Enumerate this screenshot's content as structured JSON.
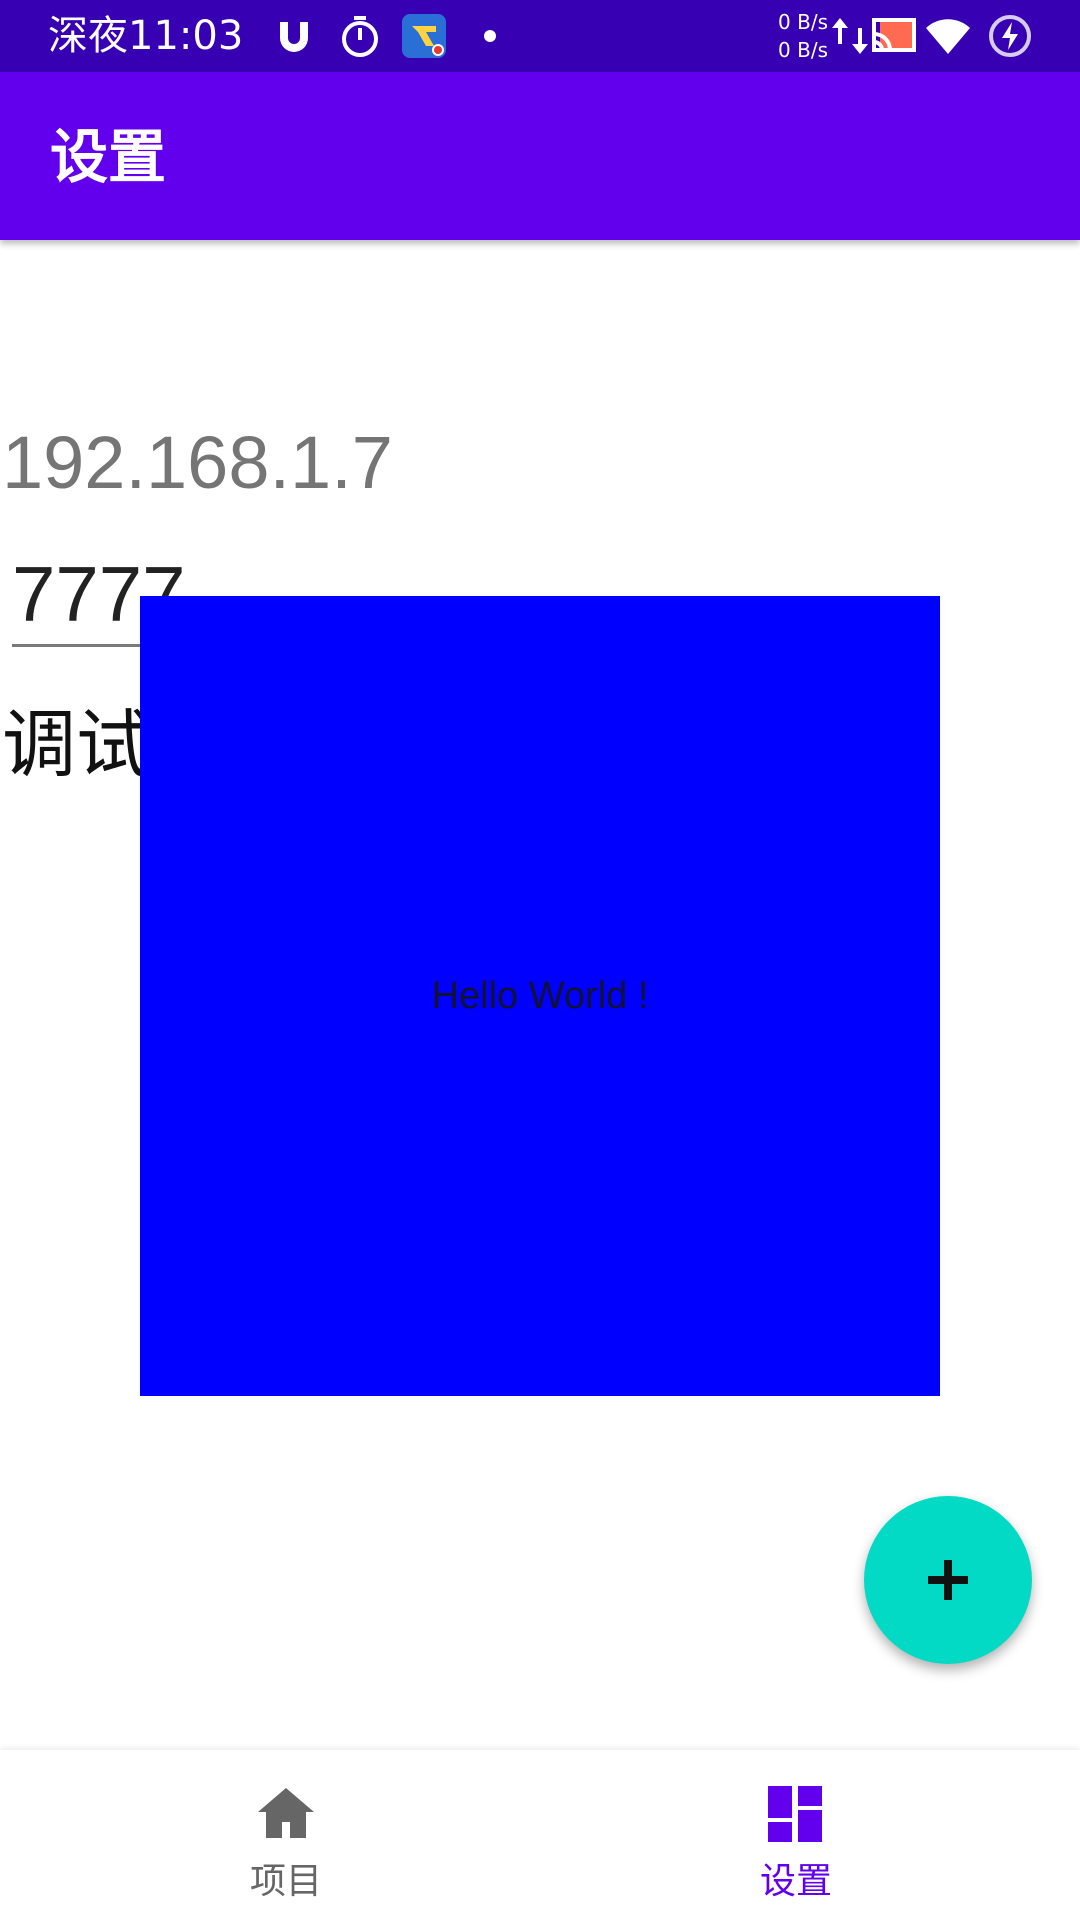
{
  "status_bar": {
    "time": "深夜11:03",
    "net_up": "0 B/s",
    "net_down": "0 B/s",
    "icons": [
      "magnet-icon",
      "timer-icon",
      "dream-app-icon",
      "dot-icon",
      "transfer-arrows-icon",
      "cast-icon",
      "wifi-icon",
      "battery-charging-icon"
    ]
  },
  "app_bar": {
    "title": "设置"
  },
  "content": {
    "ip_address": "192.168.1.7",
    "port_value": "7777",
    "debug_label": "调试",
    "overlay_text": "Hello World !"
  },
  "fab": {
    "icon": "plus-icon"
  },
  "bottom_nav": {
    "items": [
      {
        "label": "项目",
        "icon": "home-icon",
        "selected": false
      },
      {
        "label": "设置",
        "icon": "dashboard-icon",
        "selected": true
      }
    ]
  },
  "colors": {
    "status_bar": "#3700b3",
    "app_bar": "#6200ee",
    "overlay": "#0000ff",
    "fab": "#03dac5",
    "nav_selected": "#6200ee",
    "nav_unselected": "#666666"
  }
}
